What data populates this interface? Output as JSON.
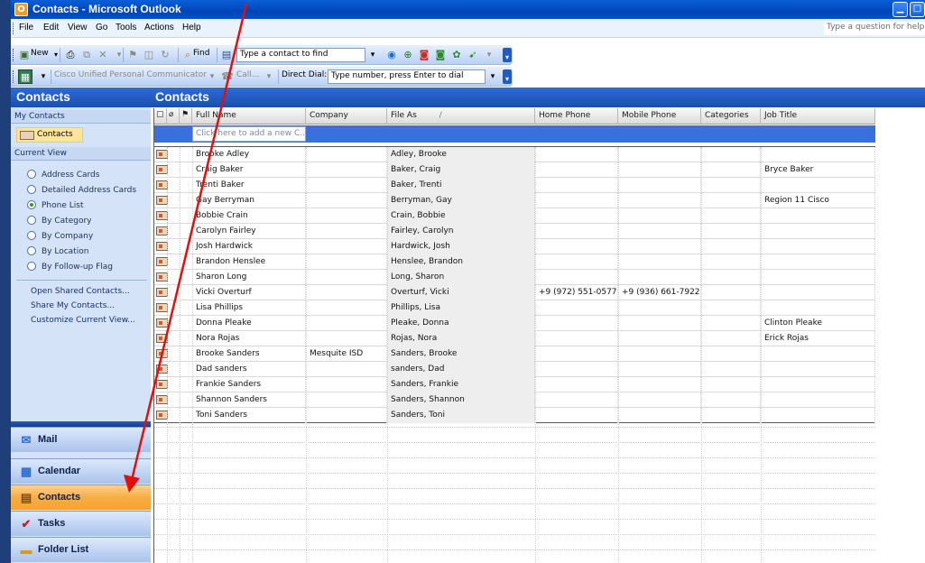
{
  "window": {
    "title": "Contacts - Microsoft Outlook",
    "min_glyph": "▁",
    "max_glyph": "□"
  },
  "menu": {
    "items": [
      "File",
      "Edit",
      "View",
      "Go",
      "Tools",
      "Actions",
      "Help"
    ],
    "help_placeholder": "Type a question for help"
  },
  "toolbar1": {
    "new_label": "New",
    "find_label": "Find",
    "find_contact_placeholder": "Type a contact to find"
  },
  "toolbar2": {
    "cupc_label": "Cisco Unified Personal Communicator",
    "call_label": "Call...",
    "direct_dial_label": "Direct Dial:",
    "direct_dial_placeholder": "Type number, press Enter to dial"
  },
  "nav": {
    "header": "Contacts",
    "my_contacts_label": "My Contacts",
    "contacts_folder": "Contacts",
    "current_view_label": "Current View",
    "views": [
      {
        "label": "Address Cards",
        "selected": false
      },
      {
        "label": "Detailed Address Cards",
        "selected": false
      },
      {
        "label": "Phone List",
        "selected": true
      },
      {
        "label": "By Category",
        "selected": false
      },
      {
        "label": "By Company",
        "selected": false
      },
      {
        "label": "By Location",
        "selected": false
      },
      {
        "label": "By Follow-up Flag",
        "selected": false
      }
    ],
    "links": [
      "Open Shared Contacts...",
      "Share My Contacts...",
      "Customize Current View..."
    ],
    "buttons": [
      {
        "label": "Mail",
        "icon": "mail-icon",
        "active": false
      },
      {
        "label": "Calendar",
        "icon": "calendar-icon",
        "active": false
      },
      {
        "label": "Contacts",
        "icon": "contacts-icon",
        "active": true
      },
      {
        "label": "Tasks",
        "icon": "tasks-icon",
        "active": false
      },
      {
        "label": "Folder List",
        "icon": "folder-icon",
        "active": false
      }
    ]
  },
  "content": {
    "header": "Contacts",
    "columns": [
      "Full Name",
      "Company",
      "File As",
      "Home Phone",
      "Mobile Phone",
      "Categories",
      "Job Title"
    ],
    "sort_indicator": "/",
    "new_row_placeholder": "Click here to add a new C...",
    "rows": [
      [
        "Brooke Adley",
        "",
        "Adley, Brooke",
        "",
        "",
        "",
        ""
      ],
      [
        "Craig Baker",
        "",
        "Baker, Craig",
        "",
        "",
        "",
        "Bryce Baker"
      ],
      [
        "Trenti Baker",
        "",
        "Baker, Trenti",
        "",
        "",
        "",
        ""
      ],
      [
        "Gay Berryman",
        "",
        "Berryman, Gay",
        "",
        "",
        "",
        "Region 11 Cisco"
      ],
      [
        "Bobbie Crain",
        "",
        "Crain, Bobbie",
        "",
        "",
        "",
        ""
      ],
      [
        "Carolyn Fairley",
        "",
        "Fairley, Carolyn",
        "",
        "",
        "",
        ""
      ],
      [
        "Josh Hardwick",
        "",
        "Hardwick, Josh",
        "",
        "",
        "",
        ""
      ],
      [
        "Brandon Henslee",
        "",
        "Henslee, Brandon",
        "",
        "",
        "",
        ""
      ],
      [
        "Sharon Long",
        "",
        "Long, Sharon",
        "",
        "",
        "",
        ""
      ],
      [
        "Vicki Overturf",
        "",
        "Overturf, Vicki",
        "+9 (972) 551-0577",
        "+9 (936) 661-7922",
        "",
        ""
      ],
      [
        "Lisa Phillips",
        "",
        "Phillips, Lisa",
        "",
        "",
        "",
        ""
      ],
      [
        "Donna Pleake",
        "",
        "Pleake, Donna",
        "",
        "",
        "",
        "Clinton Pleake"
      ],
      [
        "Nora Rojas",
        "",
        "Rojas, Nora",
        "",
        "",
        "",
        "Erick Rojas"
      ],
      [
        "Brooke Sanders",
        "Mesquite ISD",
        "Sanders, Brooke",
        "",
        "",
        "",
        ""
      ],
      [
        "Dad sanders",
        "",
        "sanders, Dad",
        "",
        "",
        "",
        ""
      ],
      [
        "Frankie Sanders",
        "",
        "Sanders, Frankie",
        "",
        "",
        "",
        ""
      ],
      [
        "Shannon Sanders",
        "",
        "Sanders, Shannon",
        "",
        "",
        "",
        ""
      ],
      [
        "Toni Sanders",
        "",
        "Sanders, Toni",
        "",
        "",
        "",
        ""
      ]
    ]
  },
  "colors": {
    "title_blue": "#0044b8",
    "header_blue": "#1b4fb0",
    "active_orange": "#f6a331",
    "annotation_red": "#e01010"
  }
}
